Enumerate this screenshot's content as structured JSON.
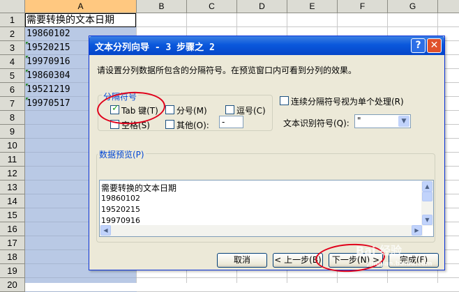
{
  "sheet": {
    "columns": [
      "A",
      "B",
      "C",
      "D",
      "E",
      "F",
      "G"
    ],
    "rows": [
      "1",
      "2",
      "3",
      "4",
      "5",
      "6",
      "7",
      "8",
      "9",
      "10",
      "11",
      "12",
      "13",
      "14",
      "15",
      "16",
      "17",
      "18",
      "19",
      "20"
    ],
    "cells": [
      "需要转换的文本日期",
      "19860102",
      "19520215",
      "19970916",
      "19860304",
      "19521219",
      "19970517"
    ]
  },
  "dialog": {
    "title": "文本分列向导 - 3 步骤之 2",
    "help_label": "?",
    "close_label": "✕",
    "instructions": "请设置分列数据所包含的分隔符号。在预览窗口内可看到分列的效果。",
    "delimiters": {
      "group_label": "分隔符号",
      "tab": "Tab 键(T)",
      "semicolon": "分号(M)",
      "comma": "逗号(C)",
      "space": "空格(S)",
      "other": "其他(O):",
      "other_value": "-"
    },
    "consecutive": "连续分隔符号视为单个处理(R)",
    "qualifier_label": "文本识别符号(Q):",
    "qualifier_value": "\"",
    "preview_label": "数据预览(P)",
    "preview_rows": [
      "需要转换的文本日期",
      "19860102",
      "19520215",
      "19970916"
    ],
    "buttons": {
      "cancel": "取消",
      "back": "< 上一步(B)",
      "next": "下一步(N) >",
      "finish": "完成(F)"
    }
  },
  "watermark": {
    "text": "Bai 经验",
    "url": "jingyan.baidu.com"
  },
  "colors": {
    "title_bar": "#0a58dc",
    "column_a": "#b9c9e5",
    "annotation": "#e0001a"
  }
}
